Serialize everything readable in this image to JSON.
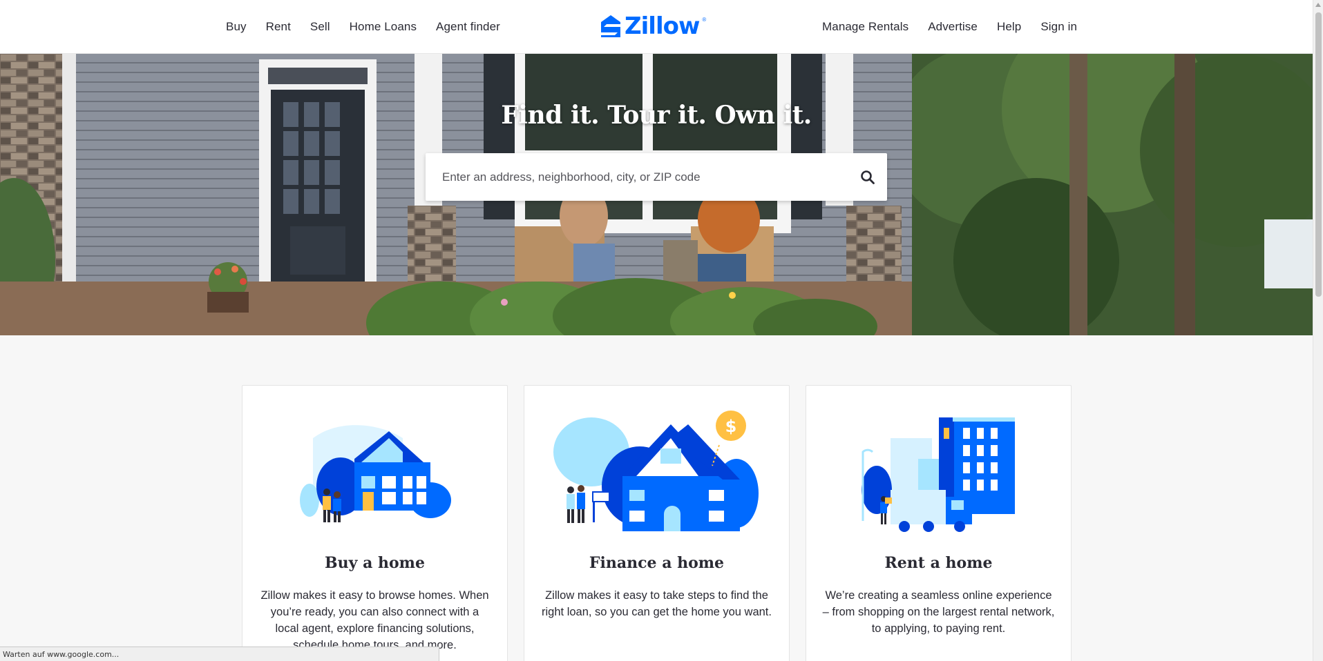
{
  "brand": {
    "name": "Zillow",
    "color": "#006aff"
  },
  "nav": {
    "left": [
      {
        "label": "Buy"
      },
      {
        "label": "Rent"
      },
      {
        "label": "Sell"
      },
      {
        "label": "Home Loans"
      },
      {
        "label": "Agent finder"
      }
    ],
    "right": [
      {
        "label": "Manage Rentals"
      },
      {
        "label": "Advertise"
      },
      {
        "label": "Help"
      },
      {
        "label": "Sign in"
      }
    ]
  },
  "hero": {
    "title": "Find it. Tour it. Own it.",
    "search": {
      "placeholder": "Enter an address, neighborhood, city, or ZIP code",
      "value": "",
      "icon": "search-icon"
    }
  },
  "cards": [
    {
      "title": "Buy a home",
      "text": "Zillow makes it easy to browse homes. When you’re ready, you can also connect with a local agent, explore financing solutions, schedule home tours, and more.",
      "illustration": "house-with-couple-illustration"
    },
    {
      "title": "Finance a home",
      "text": "Zillow makes it easy to take steps to find the right loan, so you can get the home you want.",
      "illustration": "house-with-dollar-illustration"
    },
    {
      "title": "Rent a home",
      "text": "We’re creating a seamless online experience – from shopping on the largest rental network, to applying, to paying rent.",
      "illustration": "apartment-with-truck-illustration"
    }
  ],
  "status_bar": {
    "text": "Warten auf www.google.com..."
  },
  "colors": {
    "primary_blue": "#006aff",
    "dark_blue": "#0041d9",
    "light_blue": "#a6e5ff",
    "accent_yellow": "#ffc043",
    "text": "#2a2a33"
  }
}
